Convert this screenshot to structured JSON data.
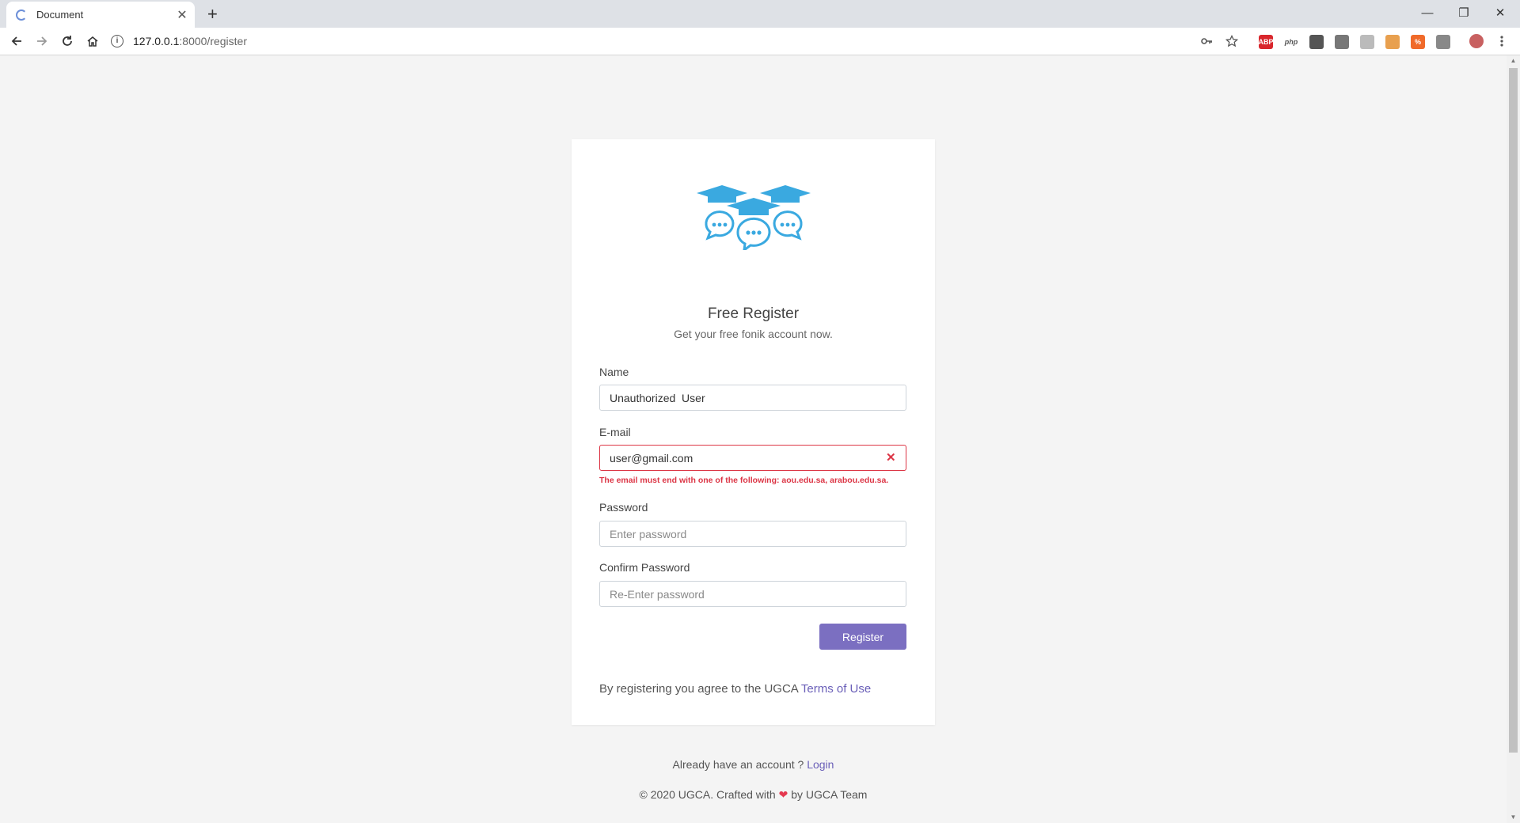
{
  "browser": {
    "tab_title": "Document",
    "url_host": "127.0.0.1",
    "url_path": ":8000/register",
    "extensions": [
      {
        "name": "adblock-plus-icon",
        "label": "ABP",
        "color": "#d9262c"
      },
      {
        "name": "php-icon",
        "label": "php",
        "color": "#ffffff"
      },
      {
        "name": "extension-leaf-icon",
        "label": "",
        "color": "#555555"
      },
      {
        "name": "camera-icon",
        "label": "",
        "color": "#777777"
      },
      {
        "name": "extension-gray-icon",
        "label": "",
        "color": "#bbbbbb"
      },
      {
        "name": "calendar-icon",
        "label": "",
        "color": "#e8a04f"
      },
      {
        "name": "percent-icon",
        "label": "%",
        "color": "#f06a2a"
      },
      {
        "name": "extension-small-icon",
        "label": "",
        "color": "#888888"
      }
    ]
  },
  "form": {
    "title": "Free Register",
    "subtitle": "Get your free fonik account now.",
    "name_label": "Name",
    "name_value": "Unauthorized  User",
    "email_label": "E-mail",
    "email_value": "user@gmail.com",
    "email_error": "The email must end with one of the following: aou.edu.sa, arabou.edu.sa.",
    "password_label": "Password",
    "password_placeholder": "Enter password",
    "confirm_label": "Confirm Password",
    "confirm_placeholder": "Re-Enter password",
    "submit_label": "Register",
    "terms_text": "By registering you agree to the UGCA ",
    "terms_link": "Terms of Use"
  },
  "footer": {
    "login_prompt": "Already have an account ? ",
    "login_link": "Login",
    "copyright_before": "© 2020 UGCA. Crafted with ",
    "copyright_after": " by UGCA Team"
  },
  "colors": {
    "accent": "#7b6fc1",
    "error": "#dc3545",
    "logo": "#3aa9e0"
  }
}
